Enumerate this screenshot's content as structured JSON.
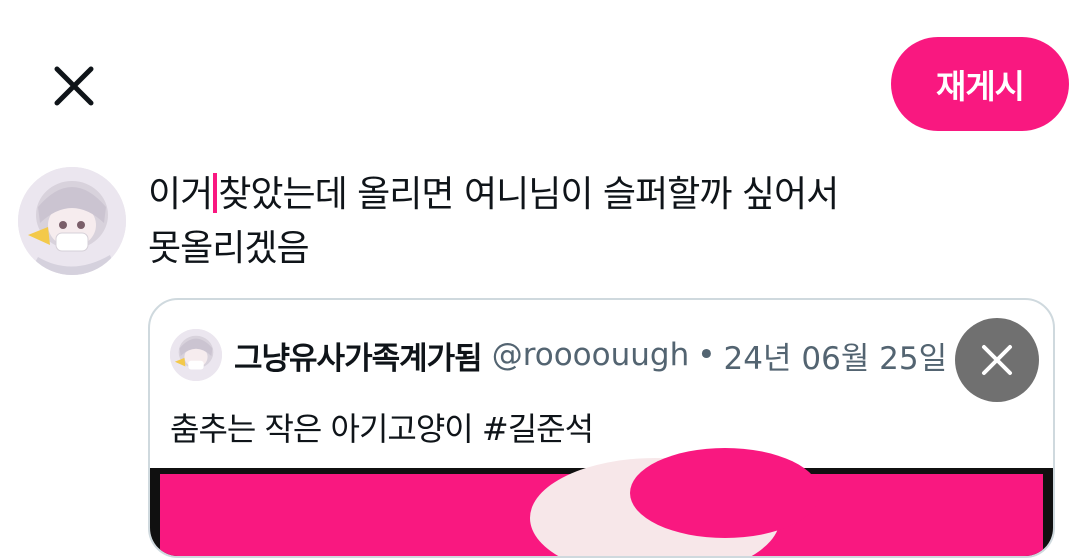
{
  "colors": {
    "accent": "#f91880",
    "text": "#0f1419",
    "secondary": "#536471",
    "border": "#cfd9de"
  },
  "header": {
    "close_icon": "close-icon",
    "repost_label": "재게시"
  },
  "compose": {
    "text_before_cursor": "이거",
    "text_after_cursor": "찾았는데 올리면 여니님이 슬퍼할까 싶어서",
    "line2": "못올리겠음"
  },
  "quote": {
    "name": "그냥유사가족계가됨",
    "handle": "@roooouugh",
    "separator": "•",
    "date": "24년 06월 25일",
    "text": "춤추는 작은 아기고양이 #길준석",
    "remove_icon": "close-icon"
  }
}
